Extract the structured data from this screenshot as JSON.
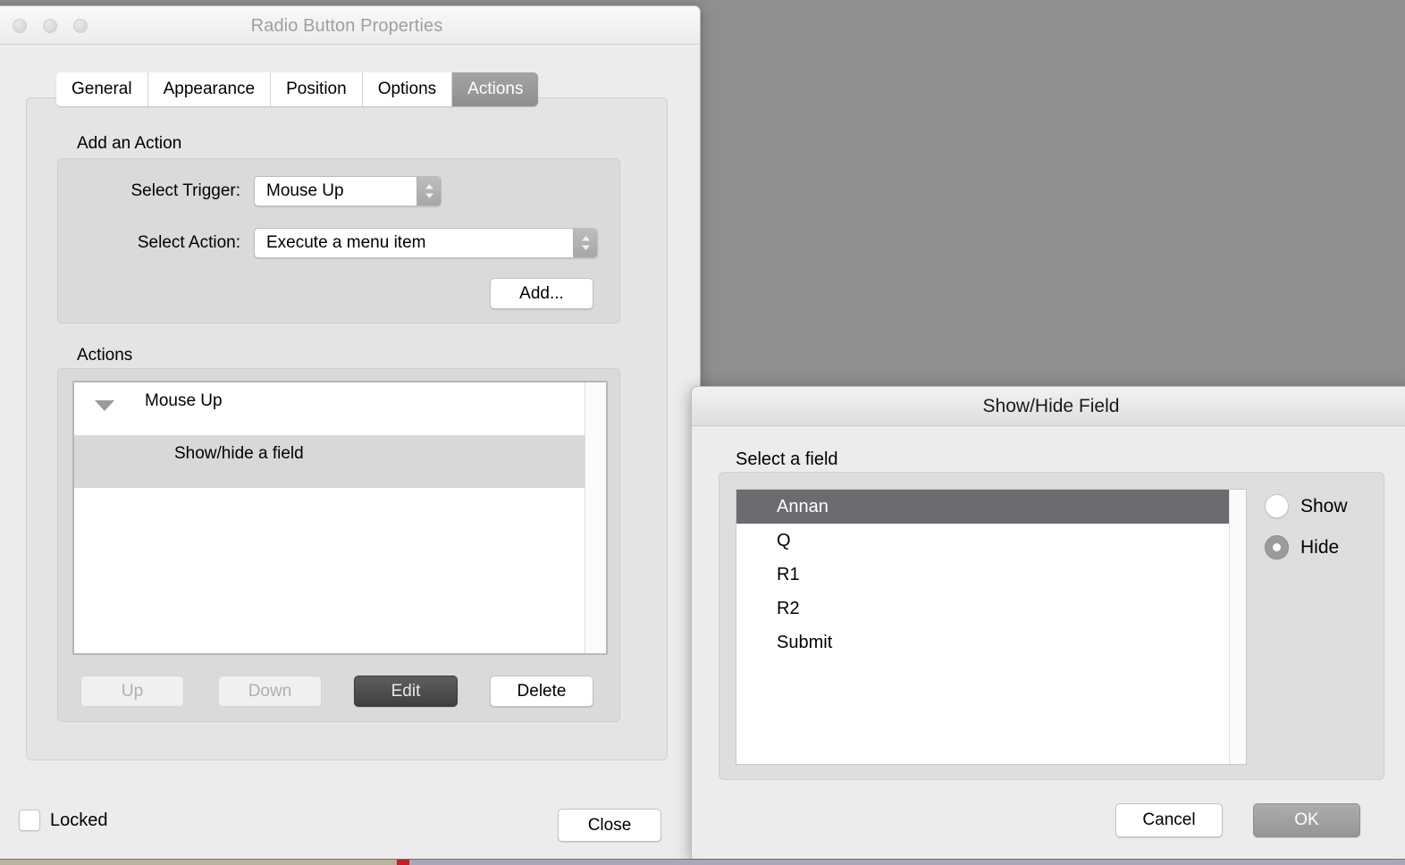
{
  "properties_window": {
    "title": "Radio Button Properties",
    "traffic_lights": [
      "close",
      "minimize",
      "zoom"
    ],
    "tabs": [
      {
        "label": "General",
        "selected": false
      },
      {
        "label": "Appearance",
        "selected": false
      },
      {
        "label": "Position",
        "selected": false
      },
      {
        "label": "Options",
        "selected": false
      },
      {
        "label": "Actions",
        "selected": true
      }
    ],
    "add_action": {
      "group_label": "Add an Action",
      "trigger_label": "Select Trigger:",
      "trigger_value": "Mouse Up",
      "action_label": "Select Action:",
      "action_value": "Execute a menu item",
      "add_button": "Add..."
    },
    "actions": {
      "group_label": "Actions",
      "tree": [
        {
          "label": "Mouse Up",
          "level": "parent",
          "expanded": true,
          "selected": false
        },
        {
          "label": "Show/hide a field",
          "level": "child",
          "expanded": false,
          "selected": true
        }
      ],
      "buttons": [
        {
          "label": "Up",
          "state": "disabled"
        },
        {
          "label": "Down",
          "state": "disabled"
        },
        {
          "label": "Edit",
          "state": "pressed"
        },
        {
          "label": "Delete",
          "state": "normal"
        }
      ]
    },
    "footer": {
      "locked_label": "Locked",
      "locked_checked": false,
      "close_button": "Close"
    }
  },
  "show_hide_dialog": {
    "title": "Show/Hide Field",
    "select_field_label": "Select a field",
    "fields": [
      {
        "label": "Annan",
        "selected": true
      },
      {
        "label": "Q",
        "selected": false
      },
      {
        "label": "R1",
        "selected": false
      },
      {
        "label": "R2",
        "selected": false
      },
      {
        "label": "Submit",
        "selected": false
      }
    ],
    "visibility_options": [
      {
        "label": "Show",
        "selected": false
      },
      {
        "label": "Hide",
        "selected": true
      }
    ],
    "cancel_button": "Cancel",
    "ok_button": "OK"
  },
  "colors": {
    "desktop_background": "#8f8f8f",
    "window_background": "#ececec",
    "selected_tab": "#8f8f8f",
    "list_selection": "#6b6b70",
    "pressed_button": "#4c4c4c",
    "default_button": "#a0a0a0"
  }
}
